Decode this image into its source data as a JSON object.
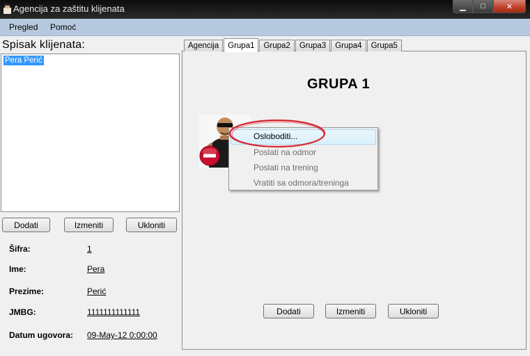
{
  "window": {
    "title": "Agencija za zaštitu klijenata",
    "controls": {
      "minimize": "▁",
      "maximize": "□",
      "close": "✕"
    }
  },
  "menu": {
    "items": [
      "Pregled",
      "Pomoć"
    ]
  },
  "clients": {
    "title": "Spisak klijenata:",
    "items": [
      "Pera Perić"
    ],
    "selected_index": 0
  },
  "client_buttons": {
    "add": "Dodati",
    "edit": "Izmeniti",
    "remove": "Ukloniti"
  },
  "details": {
    "sifra_label": "Šifra:",
    "sifra_value": "1",
    "ime_label": "Ime:",
    "ime_value": "Pera",
    "prezime_label": "Prezime:",
    "prezime_value": "Perić",
    "jmbg_label": "JMBG:",
    "jmbg_value": "1111111111111",
    "datum_label": "Datum ugovora:",
    "datum_value": "09-May-12 0:00:00"
  },
  "tabs": [
    "Agencija",
    "Grupa1",
    "Grupa2",
    "Grupa3",
    "Grupa4",
    "Grupa5"
  ],
  "active_tab_index": 1,
  "group": {
    "title": "GRUPA 1"
  },
  "group_buttons": {
    "add": "Dodati",
    "edit": "Izmeniti",
    "remove": "Ukloniti"
  },
  "context_menu": {
    "items": [
      {
        "label": "Osloboditi...",
        "enabled": true,
        "highlighted": true
      },
      {
        "label": "Poslati na odmor",
        "enabled": false
      },
      {
        "label": "Poslati na trening",
        "enabled": false
      },
      {
        "label": "Vratiti sa odmora/treninga",
        "enabled": false
      }
    ]
  },
  "colors": {
    "titlebar": "#1a1a1a",
    "menubar": "#b7c9de",
    "selection": "#3399ff",
    "annotation": "#d4202a",
    "status_icon": "#c8102e"
  },
  "icons": {
    "avatar": "bodyguard-avatar",
    "status": "no-entry-icon",
    "app": "app-icon"
  }
}
